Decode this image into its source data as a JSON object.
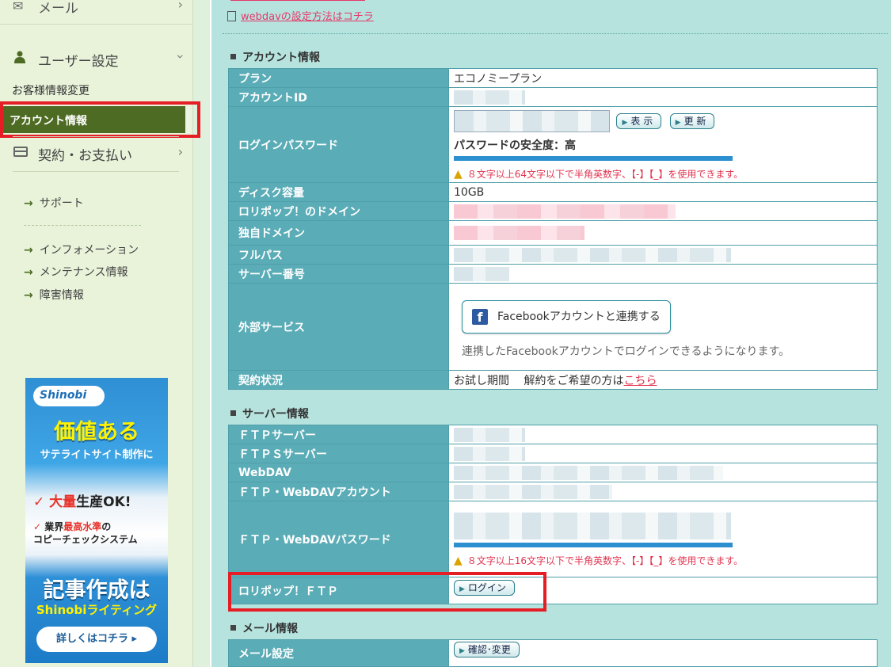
{
  "sidebar": {
    "mail_label": "メール",
    "user_settings_label": "ユーザー設定",
    "customer_info_label": "お客様情報変更",
    "account_info_label": "アカウント情報",
    "contract_label": "契約・お支払い",
    "support_label": "サポート",
    "information_label": "インフォメーション",
    "maintenance_label": "メンテナンス情報",
    "failure_label": "障害情報"
  },
  "banner": {
    "logo": "Shinobi",
    "headline1": "価値ある",
    "headline2": "サテライトサイト制作に",
    "point1_pre": "大量",
    "point1_post": "生産OK!",
    "point2_a": "業界",
    "point2_b": "最高水準",
    "point2_c": "の",
    "point2_d": "コピーチェックシステム",
    "headline3": "記事作成は",
    "headline4": "Shinobiライティング",
    "button": "詳しくはコチラ ▸"
  },
  "main": {
    "top_link": "webdavの設定方法はコチラ",
    "account_section": "アカウント情報",
    "server_section": "サーバー情報",
    "mail_section": "メール情報"
  },
  "account": {
    "plan_label": "プラン",
    "plan_value": "エコノミープラン",
    "account_id_label": "アカウントID",
    "password_label": "ログインパスワード",
    "show_button": "表 示",
    "update_button": "更 新",
    "strength_text": "パスワードの安全度：高",
    "password_rule": "８文字以上64文字以下で半角英数字、【-】【_】を使用できます。",
    "disk_label": "ディスク容量",
    "disk_value": "10GB",
    "lolipop_domain_label": "ロリポップ！のドメイン",
    "own_domain_label": "独自ドメイン",
    "fullpath_label": "フルパス",
    "server_no_label": "サーバー番号",
    "external_label": "外部サービス",
    "facebook_button": "Facebookアカウントと連携する",
    "facebook_note": "連携したFacebookアカウントでログインできるようになります。",
    "contract_status_label": "契約状況",
    "contract_status_value": "お試し期間　 解約をご希望の方は",
    "contract_link": "こちら"
  },
  "server": {
    "ftp_label": "ＦＴＰサーバー",
    "ftps_label": "ＦＴＰＳサーバー",
    "webdav_label": "WebDAV",
    "ftp_account_label": "ＦＴＰ・WebDAVアカウント",
    "ftp_password_label": "ＦＴＰ・WebDAVパスワード",
    "ftp_password_rule": "８文字以上16文字以下で半角英数字、【-】【_】を使用できます。",
    "lolipop_ftp_label": "ロリポップ！ＦＴＰ",
    "login_button": "ログイン"
  },
  "mail": {
    "mail_settings_label": "メール設定",
    "confirm_button": "確認･変更"
  },
  "colors": {
    "active_nav": "#4e6b23",
    "highlight": "#e51d25",
    "table_header": "#5aacb6",
    "main_bg": "#b7e3de"
  }
}
